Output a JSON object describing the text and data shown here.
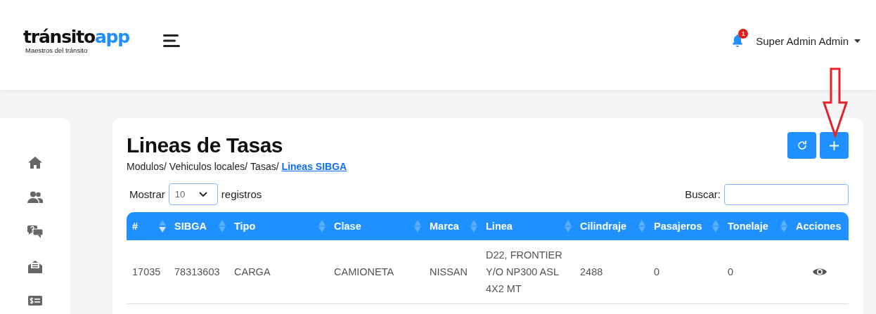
{
  "brand": {
    "name_dark": "tránsito",
    "name_accent": "app",
    "tagline": "Maestros del tránsito"
  },
  "header": {
    "notification_count": "1",
    "user": "Super Admin Admin"
  },
  "sidebar": {
    "items": [
      {
        "kind": "home"
      },
      {
        "kind": "users"
      },
      {
        "kind": "chat"
      },
      {
        "kind": "mail"
      },
      {
        "kind": "bill"
      }
    ]
  },
  "page": {
    "title": "Lineas de Tasas",
    "breadcrumb": [
      "Modulos/",
      "Vehiculos locales/",
      "Tasas/"
    ],
    "breadcrumb_current": "Lineas SIBGA"
  },
  "toolbar": {
    "buttons": [
      {
        "kind": "refresh"
      },
      {
        "kind": "add"
      }
    ]
  },
  "length": {
    "label_before": "Mostrar",
    "value": "10",
    "label_after": "registros"
  },
  "search": {
    "label": "Buscar:"
  },
  "table": {
    "columns": [
      {
        "label": "#",
        "kind": "sorted"
      },
      {
        "label": "SIBGA",
        "kind": "sortable"
      },
      {
        "label": "Tipo",
        "kind": "sortable"
      },
      {
        "label": "Clase",
        "kind": "sortable"
      },
      {
        "label": "Marca",
        "kind": "sortable"
      },
      {
        "label": "Linea",
        "kind": "sortable"
      },
      {
        "label": "Cilindraje",
        "kind": "sortable"
      },
      {
        "label": "Pasajeros",
        "kind": "sortable"
      },
      {
        "label": "Tonelaje",
        "kind": "sortable"
      },
      {
        "label": "Acciones",
        "kind": "plain"
      }
    ],
    "rows": [
      {
        "cells": [
          "17035",
          "78313603",
          "CARGA",
          "CAMIONETA",
          "NISSAN",
          "D22, FRONTIER Y/O NP300 ASL 4X2 MT",
          "2488",
          "0",
          "0"
        ],
        "actions": [
          {
            "kind": "view"
          }
        ]
      }
    ]
  },
  "annotation": {
    "kind": "arrow"
  }
}
